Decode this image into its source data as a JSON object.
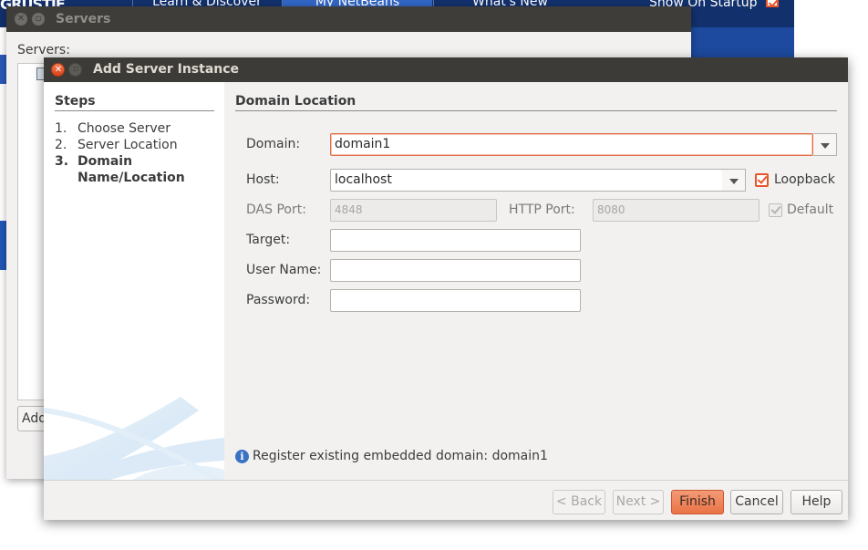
{
  "background_window": {
    "brand_text": "GRUSTIE",
    "tabs": [
      "Learn & Discover",
      "My NetBeans",
      "What's New"
    ],
    "show_on_startup_label": "Show On Startup"
  },
  "servers_window": {
    "title": "Servers",
    "servers_label": "Servers:",
    "add_button_label": "Add"
  },
  "dialog": {
    "title": "Add Server Instance",
    "steps_heading": "Steps",
    "steps": [
      {
        "num": "1.",
        "label": "Choose Server"
      },
      {
        "num": "2.",
        "label": "Server Location"
      },
      {
        "num": "3.",
        "label": "Domain",
        "label2": "Name/Location",
        "current": true
      }
    ],
    "section_heading": "Domain Location",
    "form": {
      "domain_label": "Domain:",
      "domain_value": "domain1",
      "host_label": "Host:",
      "host_value": "localhost",
      "loopback_label": "Loopback",
      "loopback_checked": true,
      "das_port_label": "DAS Port:",
      "das_port_value": "4848",
      "http_port_label": "HTTP Port:",
      "http_port_value": "8080",
      "default_label": "Default",
      "default_checked": true,
      "target_label": "Target:",
      "target_value": "",
      "username_label": "User Name:",
      "username_value": "",
      "password_label": "Password:",
      "password_value": ""
    },
    "info_message": "Register existing embedded domain: domain1",
    "buttons": {
      "back": "< Back",
      "next": "Next >",
      "finish": "Finish",
      "cancel": "Cancel",
      "help": "Help"
    }
  },
  "colors": {
    "accent_orange": "#e8552b",
    "title_bar": "#3c3b37",
    "netbeans_blue": "#12306b"
  }
}
